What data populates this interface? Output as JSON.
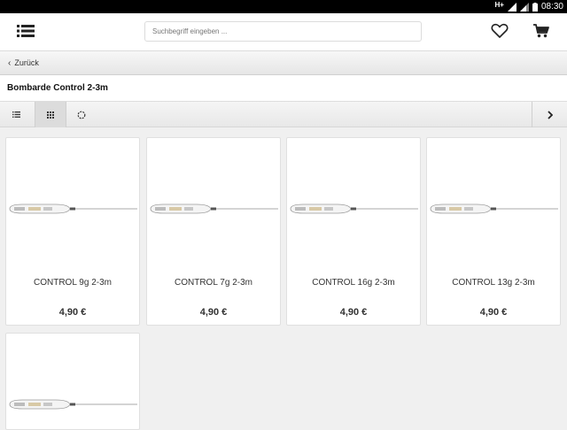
{
  "status": {
    "network": "H+",
    "time": "08:30"
  },
  "header": {
    "search_placeholder": "Suchbegriff eingeben ..."
  },
  "nav": {
    "back_label": "Zurück"
  },
  "page": {
    "title": "Bombarde Control 2-3m"
  },
  "products": [
    {
      "name": "CONTROL 9g 2-3m",
      "price": "4,90 €"
    },
    {
      "name": "CONTROL 7g 2-3m",
      "price": "4,90 €"
    },
    {
      "name": "CONTROL 16g 2-3m",
      "price": "4,90 €"
    },
    {
      "name": "CONTROL 13g 2-3m",
      "price": "4,90 €"
    },
    {
      "name": "",
      "price": ""
    }
  ]
}
